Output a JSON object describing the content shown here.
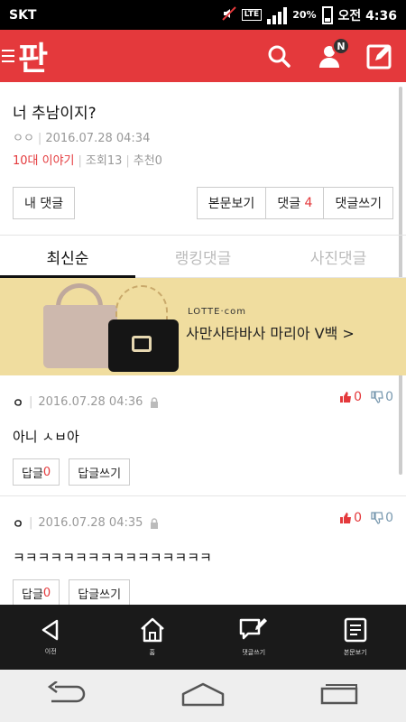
{
  "status_bar": {
    "carrier": "SKT",
    "network": "LTE",
    "battery": "20%",
    "time": "오전 4:36"
  },
  "app_bar": {
    "logo": "판",
    "notification_badge": "N",
    "accent_color": "#e4393c"
  },
  "post": {
    "title": "너 추남이지?",
    "author": "ㅇㅇ",
    "date": "2016.07.28 04:34",
    "category": "10대 이야기",
    "views": "조회13",
    "recommends": "추천0"
  },
  "post_actions": {
    "my_comments": "내 댓글",
    "view_body": "본문보기",
    "comments_label": "댓글",
    "comments_count": "4",
    "write_comment": "댓글쓰기"
  },
  "tabs": [
    {
      "label": "최신순",
      "active": true
    },
    {
      "label": "랭킹댓글",
      "active": false
    },
    {
      "label": "사진댓글",
      "active": false
    }
  ],
  "ad": {
    "brand": "LOTTE·com",
    "text": "사만사타바사 마리아 V백 >"
  },
  "comments": [
    {
      "author": "ㅇ",
      "date": "2016.07.28 04:36",
      "text": "아니 ㅅㅂ아",
      "up": "0",
      "down": "0",
      "reply_label": "답글",
      "reply_count": "0",
      "write_reply": "답글쓰기"
    },
    {
      "author": "ㅇ",
      "date": "2016.07.28 04:35",
      "text": "ㅋㅋㅋㅋㅋㅋㅋㅋㅋㅋㅋㅋㅋㅋㅋㅋ",
      "up": "0",
      "down": "0",
      "reply_label": "답글",
      "reply_count": "0",
      "write_reply": "답글쓰기"
    }
  ],
  "toolbar": {
    "prev": "이전",
    "home": "홈",
    "write_comment": "댓글쓰기",
    "view_body": "본문보기"
  }
}
